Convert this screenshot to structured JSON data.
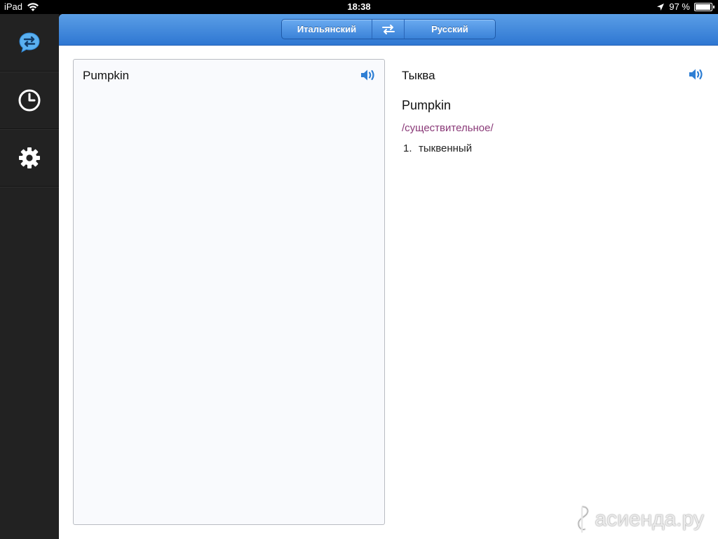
{
  "status_bar": {
    "device": "iPad",
    "time": "18:38",
    "battery_text": "97 %",
    "battery_level": 0.97
  },
  "sidebar": {
    "items": [
      {
        "icon": "translate-bubble-icon",
        "active": true
      },
      {
        "icon": "clock-icon",
        "active": false
      },
      {
        "icon": "gear-icon",
        "active": false
      }
    ]
  },
  "toolbar": {
    "source_language": "Итальянский",
    "target_language": "Русский",
    "swap_icon": "swap-arrows-icon"
  },
  "input": {
    "text": "Pumpkin",
    "speaker_icon": "speaker-icon"
  },
  "result": {
    "translation": "Тыква",
    "headword": "Pumpkin",
    "part_of_speech": "/существительное/",
    "meanings": [
      {
        "num": "1.",
        "text": "тыквенный"
      }
    ]
  },
  "watermark": {
    "text": "асиенда.ру"
  },
  "colors": {
    "accent": "#3a82d8",
    "part_of_speech": "#8a3a78",
    "sidebar": "#222222"
  }
}
